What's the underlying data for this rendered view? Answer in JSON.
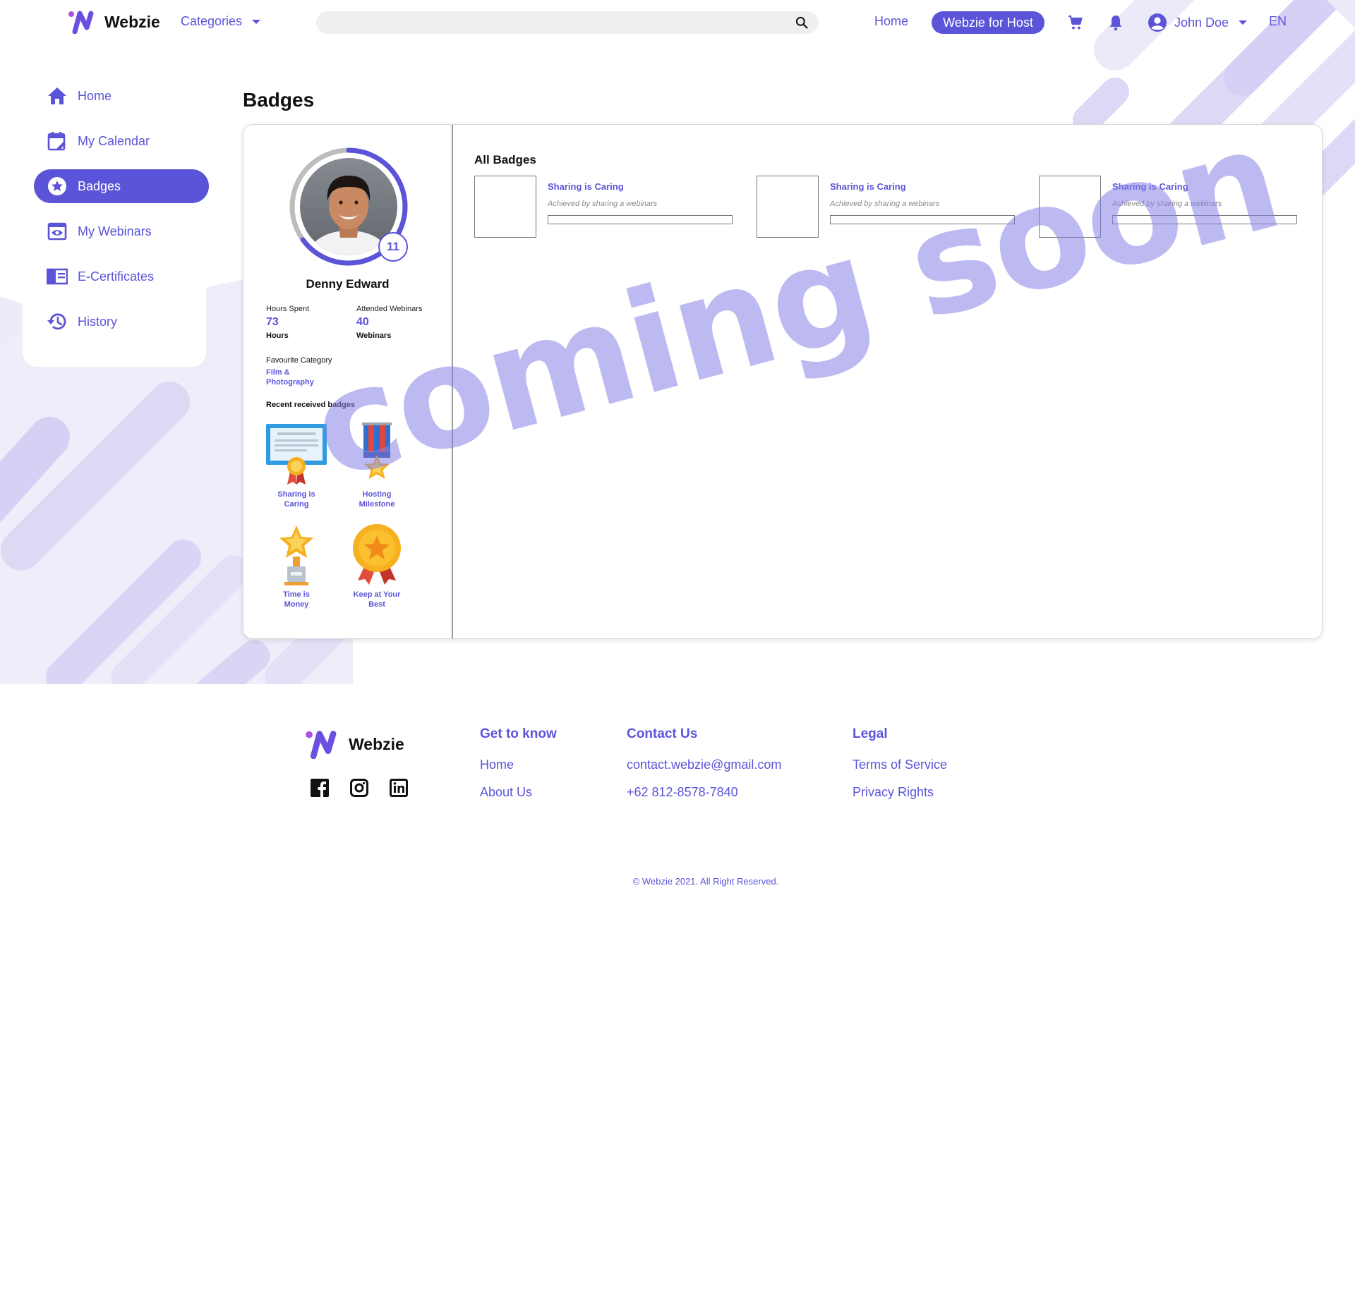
{
  "brand": {
    "name": "Webzie",
    "accent": "#5b54d8"
  },
  "header": {
    "categories_label": "Categories",
    "search_placeholder": "",
    "home_label": "Home",
    "host_button_label": "Webzie for Host",
    "user_name": "John Doe",
    "language": "EN"
  },
  "sidebar": {
    "items": [
      {
        "label": "Home",
        "icon": "home-icon",
        "active": false
      },
      {
        "label": "My Calendar",
        "icon": "calendar-icon",
        "active": false
      },
      {
        "label": "Badges",
        "icon": "star-badge-icon",
        "active": true
      },
      {
        "label": "My Webinars",
        "icon": "eye-icon",
        "active": false
      },
      {
        "label": "E-Certificates",
        "icon": "certificate-icon",
        "active": false
      },
      {
        "label": "History",
        "icon": "history-icon",
        "active": false
      }
    ]
  },
  "page": {
    "title": "Badges"
  },
  "profile": {
    "name": "Denny Edward",
    "level": "11",
    "level_progress": 0.65,
    "hours_label": "Hours Spent",
    "hours_value": "73",
    "hours_unit": "Hours",
    "webinars_label": "Attended Webinars",
    "webinars_value": "40",
    "webinars_unit": "Webinars",
    "favourite_label": "Favourite Category",
    "favourite_value": "Film & Photography",
    "recent_title": "Recent received badges",
    "recent_badges": [
      {
        "label": "Sharing is Caring",
        "icon": "certificate-medal-icon"
      },
      {
        "label": "Hosting Milestone",
        "icon": "ribbon-star-medal-icon"
      },
      {
        "label": "Time is Money",
        "icon": "star-trophy-icon"
      },
      {
        "label": "Keep at Your Best",
        "icon": "gold-medal-icon"
      }
    ]
  },
  "all_badges": {
    "title": "All Badges",
    "items": [
      {
        "title": "Sharing is Caring",
        "desc": "Achieved by sharing a webinars",
        "progress": 0
      },
      {
        "title": "Sharing is Caring",
        "desc": "Achieved by sharing a webinars",
        "progress": 0
      },
      {
        "title": "Sharing is Caring",
        "desc": "Achieved by sharing a webinars",
        "progress": 0
      }
    ]
  },
  "overlay": {
    "text": "coming soon"
  },
  "footer": {
    "brand": "Webzie",
    "social": [
      "facebook-icon",
      "instagram-icon",
      "linkedin-icon"
    ],
    "get_to_know": {
      "heading": "Get to know",
      "links": [
        "Home",
        "About Us"
      ]
    },
    "contact": {
      "heading": "Contact Us",
      "email": "contact.webzie@gmail.com",
      "phone": "+62 812-8578-7840"
    },
    "legal": {
      "heading": "Legal",
      "links": [
        "Terms of Service",
        "Privacy Rights"
      ]
    },
    "copyright": "© Webzie 2021. All Right Reserved."
  }
}
